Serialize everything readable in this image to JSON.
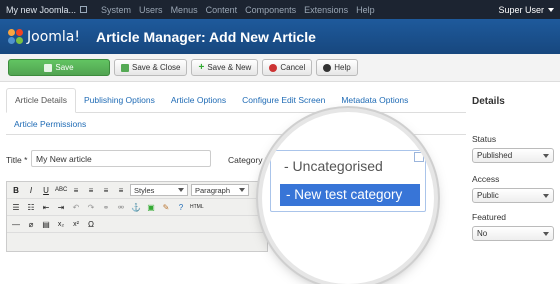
{
  "topbar": {
    "site_name": "My new Joomla...",
    "menu": [
      "System",
      "Users",
      "Menus",
      "Content",
      "Components",
      "Extensions",
      "Help"
    ],
    "user": "Super User"
  },
  "header": {
    "logo_text": "Joomla!",
    "title": "Article Manager: Add New Article"
  },
  "toolbar": {
    "save": "Save",
    "save_close": "Save & Close",
    "save_new": "Save & New",
    "cancel": "Cancel",
    "help": "Help"
  },
  "tabs": {
    "row1": [
      "Article Details",
      "Publishing Options",
      "Article Options",
      "Configure Edit Screen",
      "Metadata Options"
    ],
    "row2": [
      "Article Permissions"
    ]
  },
  "form": {
    "title_label": "Title *",
    "title_value": "My New article",
    "category_label": "Category *"
  },
  "editor": {
    "styles": "Styles",
    "paragraph": "Paragraph"
  },
  "category_dropdown": {
    "options": [
      "- Uncategorised",
      "- New test category"
    ],
    "selected_index": 1
  },
  "sidebar": {
    "heading": "Details",
    "status_label": "Status",
    "status_value": "Published",
    "access_label": "Access",
    "access_value": "Public",
    "featured_label": "Featured",
    "featured_value": "No"
  }
}
